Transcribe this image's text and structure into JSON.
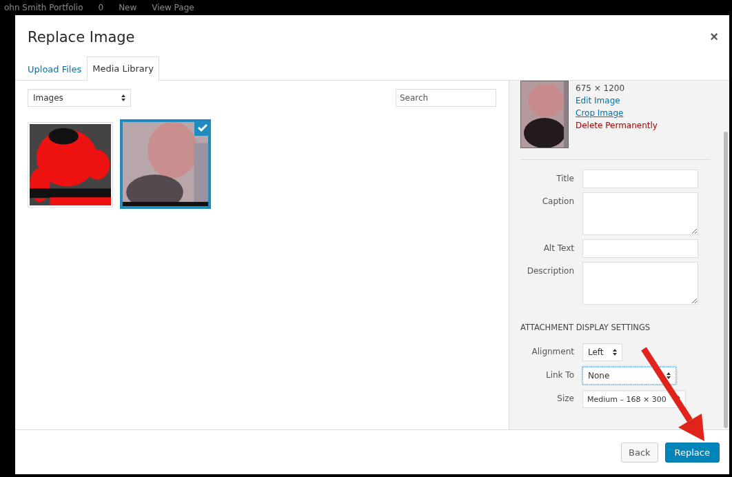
{
  "top_bar": {
    "items": [
      "ohn Smith Portfolio",
      "0",
      "New",
      "View Page"
    ]
  },
  "window": {
    "title": "Replace Image",
    "close": "×"
  },
  "tabs": [
    {
      "label": "Upload Files",
      "selected": false
    },
    {
      "label": "Media Library",
      "selected": true
    }
  ],
  "filter": {
    "value": "Images"
  },
  "search": {
    "placeholder": "Search"
  },
  "attachments": [
    {
      "kind": "picture",
      "selected": false
    },
    {
      "kind": "picture",
      "selected": true
    }
  ],
  "details": {
    "dimensions": "675 × 1200",
    "links": [
      {
        "label": "Edit Image",
        "kind": "link"
      },
      {
        "label": "Crop Image",
        "kind": "link"
      },
      {
        "label": "Delete Permanently",
        "kind": "danger"
      }
    ]
  },
  "fields": [
    {
      "label": "Title",
      "kind": "input"
    },
    {
      "label": "Caption",
      "kind": "textarea"
    },
    {
      "label": "Alt Text",
      "kind": "input"
    },
    {
      "label": "Description",
      "kind": "textarea"
    }
  ],
  "display_settings": {
    "heading": "ATTACHMENT DISPLAY SETTINGS",
    "settings": [
      {
        "label": "Alignment",
        "value": "Left",
        "focused": false
      },
      {
        "label": "Link To",
        "value": "None",
        "focused": true
      },
      {
        "label": "Size",
        "value": "Medium – 168 × 300",
        "focused": false
      }
    ]
  },
  "buttons": [
    {
      "label": "Back",
      "kind": "secondary"
    },
    {
      "label": "Replace",
      "kind": "primary"
    }
  ]
}
